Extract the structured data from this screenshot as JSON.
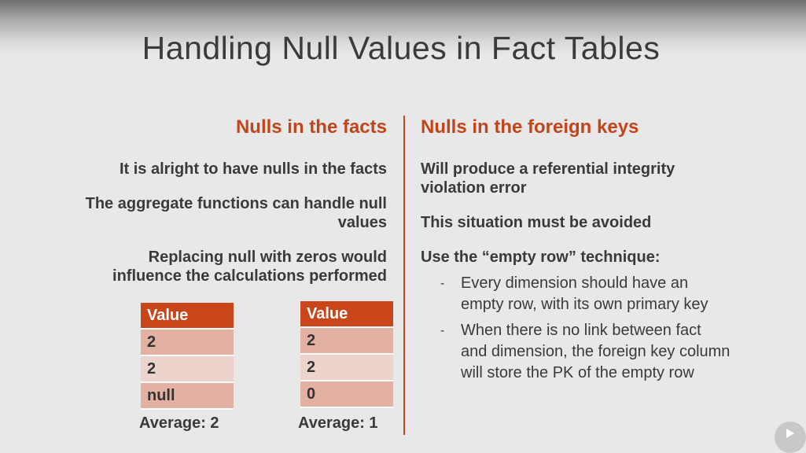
{
  "slide": {
    "title": "Handling Null Values in Fact Tables"
  },
  "left": {
    "heading": "Nulls in the facts",
    "points": [
      "It is alright to have nulls in the facts",
      "The aggregate functions can handle null",
      "values",
      "Replacing null with zeros would",
      "influence the calculations performed"
    ],
    "table1": {
      "header": "Value",
      "rows": [
        "2",
        "2",
        "null"
      ],
      "average": "Average: 2"
    },
    "table2": {
      "header": "Value",
      "rows": [
        "2",
        "2",
        "0"
      ],
      "average": "Average: 1"
    }
  },
  "right": {
    "heading": "Nulls in the foreign keys",
    "points": [
      "Will produce a referential integrity",
      "violation error",
      "This situation must be avoided",
      "Use the “empty row” technique:"
    ],
    "bullets": [
      {
        "line1": "Every dimension should have an",
        "line2": "empty row, with its own primary key"
      },
      {
        "line1": "When there is no link between fact",
        "line2": "and dimension, the foreign key column",
        "line3": "will store the PK of the empty row"
      }
    ],
    "dash": "-"
  },
  "colors": {
    "accent": "#c2441a",
    "table_header": "#c9461a",
    "row_dark": "#e3b1a2",
    "row_light": "#ecd3cb"
  }
}
